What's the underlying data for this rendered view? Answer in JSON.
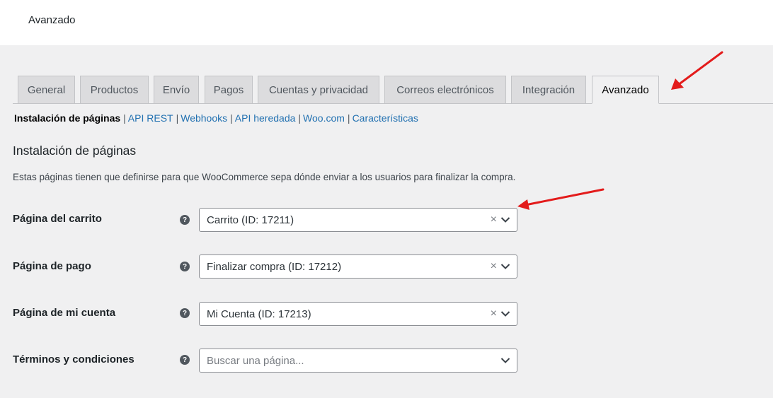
{
  "topbar": {
    "title": "Avanzado"
  },
  "tabs": [
    {
      "label": "General"
    },
    {
      "label": "Productos"
    },
    {
      "label": "Envío"
    },
    {
      "label": "Pagos"
    },
    {
      "label": "Cuentas y privacidad"
    },
    {
      "label": "Correos electrónicos"
    },
    {
      "label": "Integración"
    },
    {
      "label": "Avanzado"
    }
  ],
  "subnav": {
    "current": "Instalación de páginas",
    "sep": "|",
    "links": [
      "API REST",
      "Webhooks",
      "API heredada",
      "Woo.com",
      "Características"
    ]
  },
  "section": {
    "title": "Instalación de páginas",
    "description": "Estas páginas tienen que definirse para que WooCommerce sepa dónde enviar a los usuarios para finalizar la compra."
  },
  "help_glyph": "?",
  "clear_glyph": "×",
  "rows": [
    {
      "label": "Página del carrito",
      "value": "Carrito (ID: 17211)"
    },
    {
      "label": "Página de pago",
      "value": "Finalizar compra (ID: 17212)"
    },
    {
      "label": "Página de mi cuenta",
      "value": "Mi Cuenta (ID: 17213)"
    },
    {
      "label": "Términos y condiciones",
      "placeholder": "Buscar una página..."
    }
  ],
  "colors": {
    "link": "#2271b1",
    "annotation_arrow": "#e31b1b",
    "background": "#f0f0f1"
  }
}
